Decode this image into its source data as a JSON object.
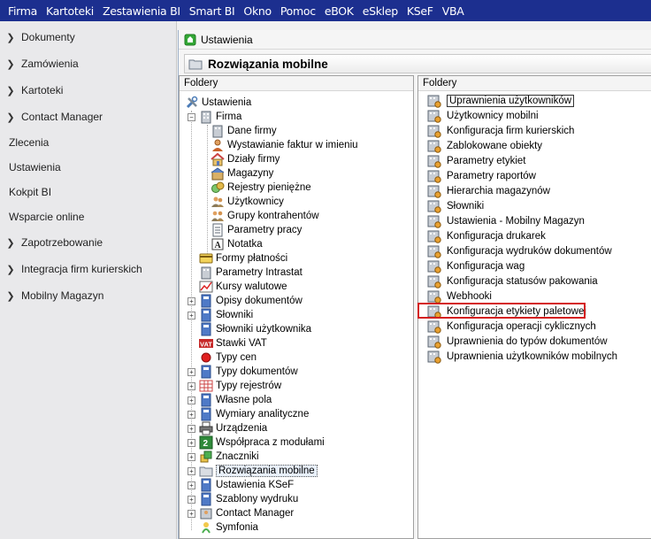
{
  "menu": [
    "Firma",
    "Kartoteki",
    "Zestawienia BI",
    "Smart BI",
    "Okno",
    "Pomoc",
    "eBOK",
    "eSklep",
    "KSeF",
    "VBA"
  ],
  "sidebar": [
    {
      "label": "Dokumenty",
      "chevron": true
    },
    {
      "label": "Zamówienia",
      "chevron": true
    },
    {
      "label": "Kartoteki",
      "chevron": true
    },
    {
      "label": "Contact Manager",
      "chevron": true
    },
    {
      "label": "Zlecenia",
      "chevron": false
    },
    {
      "label": "Ustawienia",
      "chevron": false
    },
    {
      "label": "Kokpit BI",
      "chevron": false
    },
    {
      "label": "Wsparcie online",
      "chevron": false
    },
    {
      "label": "Zapotrzebowanie",
      "chevron": true
    },
    {
      "label": "Integracja firm kurierskich",
      "chevron": true
    },
    {
      "label": "Mobilny Magazyn",
      "chevron": true
    }
  ],
  "window": {
    "title": "Ustawienia",
    "subtitle": "Rozwiązania mobilne"
  },
  "left_pane": {
    "header": "Foldery",
    "root": "Ustawienia",
    "firma": "Firma",
    "firma_children": [
      "Dane firmy",
      "Wystawianie faktur w imieniu",
      "Działy firmy",
      "Magazyny",
      "Rejestry pieniężne",
      "Użytkownicy",
      "Grupy kontrahentów",
      "Parametry pracy",
      "Notatka"
    ],
    "items": [
      "Formy płatności",
      "Parametry Intrastat",
      "Kursy walutowe",
      "Opisy dokumentów",
      "Słowniki",
      "Słowniki użytkownika",
      "Stawki VAT",
      "Typy cen",
      "Typy dokumentów",
      "Typy rejestrów",
      "Własne pola",
      "Wymiary analityczne",
      "Urządzenia",
      "Współpraca z modułami",
      "Znaczniki",
      "Rozwiązania mobilne",
      "Ustawienia KSeF",
      "Szablony wydruku",
      "Contact Manager",
      "Symfonia"
    ]
  },
  "right_pane": {
    "header": "Foldery",
    "items": [
      "Uprawnienia użytkowników",
      "Użytkownicy mobilni",
      "Konfiguracja firm kurierskich",
      "Zablokowane obiekty",
      "Parametry etykiet",
      "Parametry raportów",
      "Hierarchia magazynów",
      "Słowniki",
      "Ustawienia - Mobilny Magazyn",
      "Konfiguracja drukarek",
      "Konfiguracja wydruków dokumentów",
      "Konfiguracja wag",
      "Konfiguracja statusów pakowania",
      "Webhooki",
      "Konfiguracja etykiety paletowej",
      "Konfiguracja operacji cyklicznych",
      "Uprawnienia do typów dokumentów",
      "Uprawnienia użytkowników mobilnych"
    ]
  },
  "colors": {
    "menubar": "#1c2f8f",
    "highlight": "#d41f1f"
  }
}
